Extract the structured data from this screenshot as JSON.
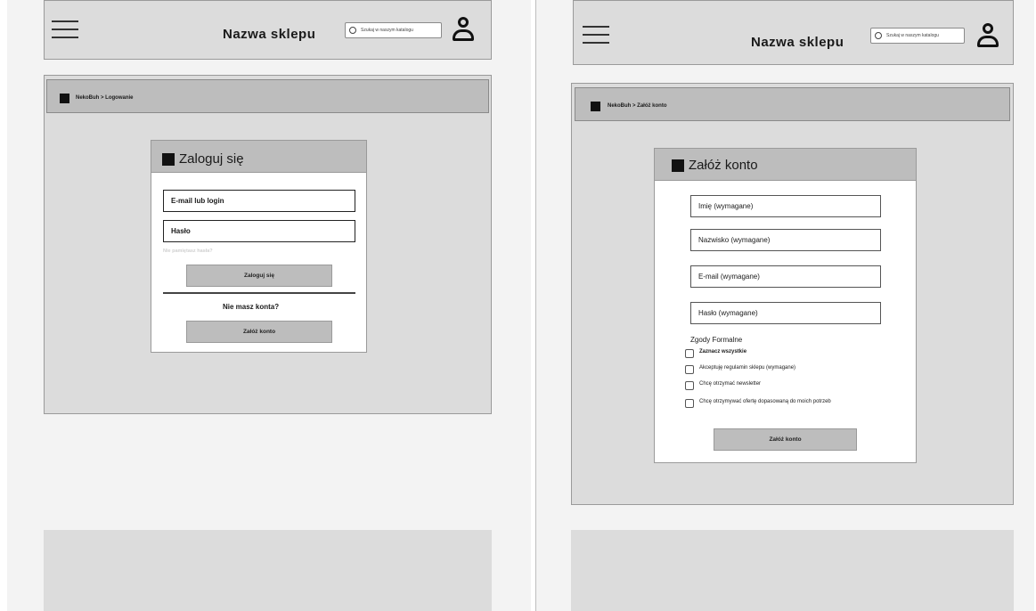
{
  "header": {
    "shop_name": "Nazwa sklepu",
    "search_placeholder": "Szukaj w naszym katalogu"
  },
  "login_page": {
    "breadcrumb": "NekoBuh > Logowanie",
    "card_title": "Zaloguj się",
    "login_field": "E-mail lub login",
    "password_field": "Hasło",
    "forgot_password": "Nie pamiętasz hasła?",
    "login_button": "Zaloguj się",
    "no_account": "Nie masz konta?",
    "register_button": "Załóż konto"
  },
  "register_page": {
    "breadcrumb": "NekoBuh > Załóż konto",
    "card_title": "Załóż konto",
    "fields": [
      "Imię (wymagane)",
      "Nazwisko (wymagane)",
      "E-mail (wymagane)",
      "Hasło (wymagane)"
    ],
    "consents_label": "Zgody Formalne",
    "consents": [
      "Zaznacz wszystkie",
      "Akceptuję regulamin sklepu (wymagane)",
      "Chcę otrzymać newsletter",
      "Chcę otrzymywać ofertę dopasowaną do moich potrzeb"
    ],
    "register_button": "Załóż konto"
  }
}
